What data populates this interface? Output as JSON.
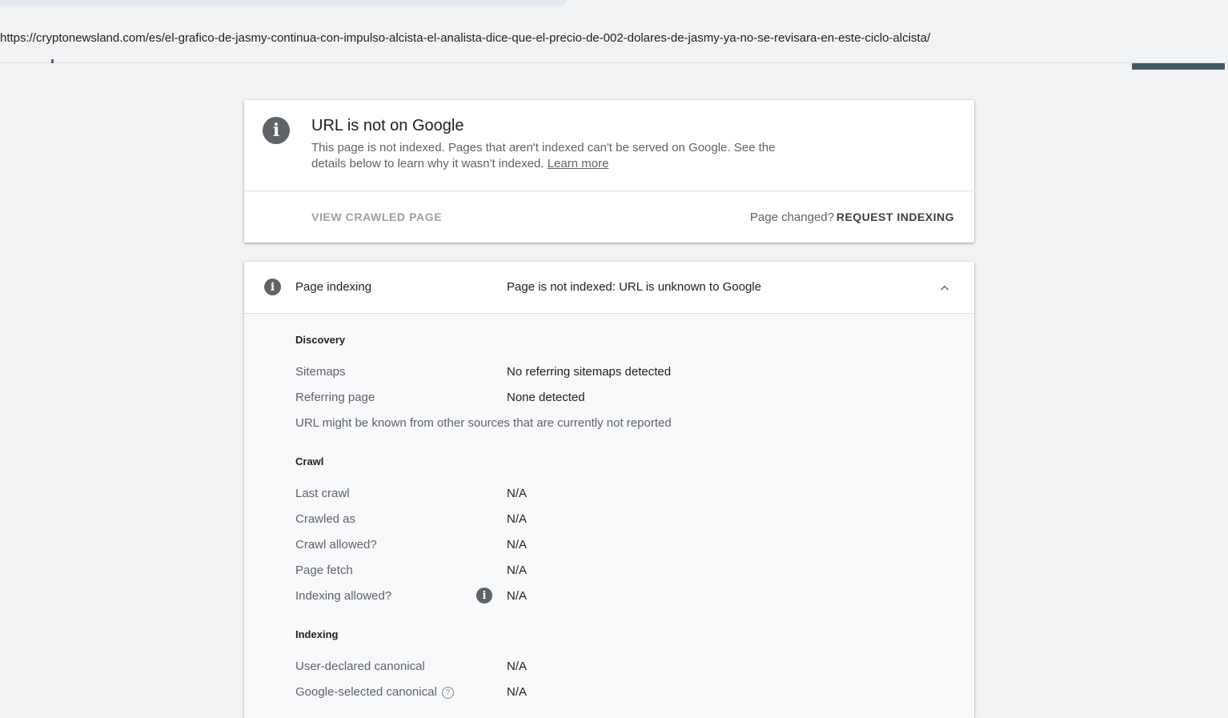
{
  "url_bar": {
    "url": "https://cryptonewsland.com/es/el-grafico-de-jasmy-continua-con-impulso-alcista-el-analista-dice-que-el-precio-de-002-dolares-de-jasmy-ya-no-se-revisara-en-este-ciclo-alcista/"
  },
  "status_card": {
    "icon": "info-icon",
    "title": "URL is not on Google",
    "description": "This page is not indexed. Pages that aren't indexed can't be served on Google. See the details below to learn why it wasn't indexed.",
    "learn_more": "Learn more",
    "view_crawled": "VIEW CRAWLED PAGE",
    "page_changed": "Page changed?",
    "request_indexing": "REQUEST INDEXING"
  },
  "indexing_card": {
    "label": "Page indexing",
    "status": "Page is not indexed: URL is unknown to Google",
    "discovery": {
      "title": "Discovery",
      "sitemaps_label": "Sitemaps",
      "sitemaps_value": "No referring sitemaps detected",
      "referring_label": "Referring page",
      "referring_value": "None detected",
      "note": "URL might be known from other sources that are currently not reported"
    },
    "crawl": {
      "title": "Crawl",
      "last_crawl_label": "Last crawl",
      "last_crawl_value": "N/A",
      "crawled_as_label": "Crawled as",
      "crawled_as_value": "N/A",
      "crawl_allowed_label": "Crawl allowed?",
      "crawl_allowed_value": "N/A",
      "page_fetch_label": "Page fetch",
      "page_fetch_value": "N/A",
      "indexing_allowed_label": "Indexing allowed?",
      "indexing_allowed_value": "N/A"
    },
    "indexing": {
      "title": "Indexing",
      "user_canonical_label": "User-declared canonical",
      "user_canonical_value": "N/A",
      "google_canonical_label": "Google-selected canonical",
      "google_canonical_value": "N/A"
    }
  }
}
